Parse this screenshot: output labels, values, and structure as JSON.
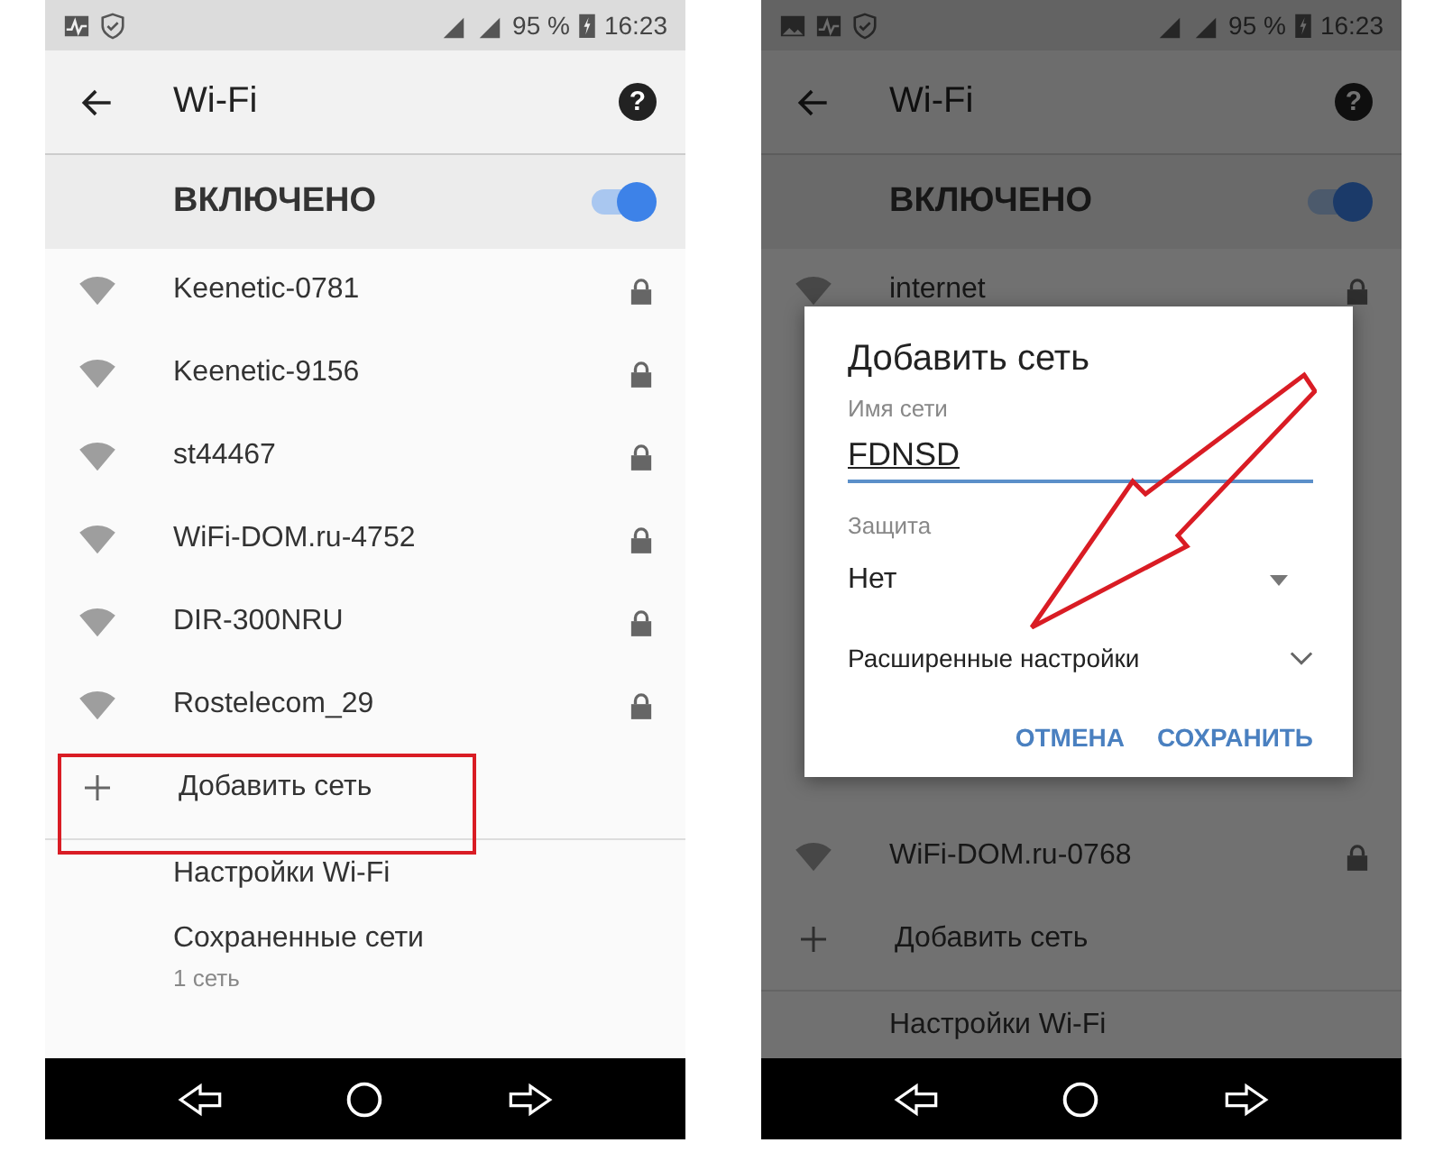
{
  "phones": [
    {
      "notifications": [
        {
          "kind": "pulse"
        },
        {
          "kind": "shield"
        }
      ],
      "battery": "95 %",
      "time": "16:23",
      "title": "Wi-Fi",
      "help": "?",
      "switch_label": "ВКЛЮЧЕНО",
      "switch_on": true,
      "dimmed": false,
      "arrow_annotation": false,
      "networks": [
        {
          "name": "Keenetic-0781",
          "secured": true
        },
        {
          "name": "Keenetic-9156",
          "secured": true
        },
        {
          "name": "st44467",
          "secured": true
        },
        {
          "name": "WiFi-DOM.ru-4752",
          "secured": true
        },
        {
          "name": "DIR-300NRU",
          "secured": true
        },
        {
          "name": "Rostelecom_29",
          "secured": true
        }
      ],
      "add_network": {
        "label": "Добавить сеть",
        "highlighted": true
      },
      "menu": [
        {
          "label": "Настройки Wi-Fi"
        },
        {
          "label": "Сохраненные сети",
          "sub": "1 сеть"
        }
      ]
    },
    {
      "notifications": [
        {
          "kind": "image"
        },
        {
          "kind": "pulse"
        },
        {
          "kind": "shield"
        }
      ],
      "battery": "95 %",
      "time": "16:23",
      "title": "Wi-Fi",
      "help": "?",
      "switch_label": "ВКЛЮЧЕНО",
      "switch_on": true,
      "dimmed": true,
      "arrow_annotation": true,
      "networks": [
        {
          "name": "internet",
          "secured": true
        }
      ],
      "lower_networks": [
        {
          "name": "WiFi-DOM.ru-0768",
          "secured": true
        }
      ],
      "add_network": {
        "label": "Добавить сеть",
        "highlighted": false
      },
      "menu": [
        {
          "label": "Настройки Wi-Fi"
        }
      ],
      "dialog": {
        "title": "Добавить сеть",
        "name_label": "Имя сети",
        "name_value": "FDNSD",
        "security_label": "Защита",
        "security_value": "Нет",
        "advanced": "Расширенные настройки",
        "buttons": [
          "ОТМЕНА",
          "СОХРАНИТЬ"
        ]
      }
    }
  ]
}
